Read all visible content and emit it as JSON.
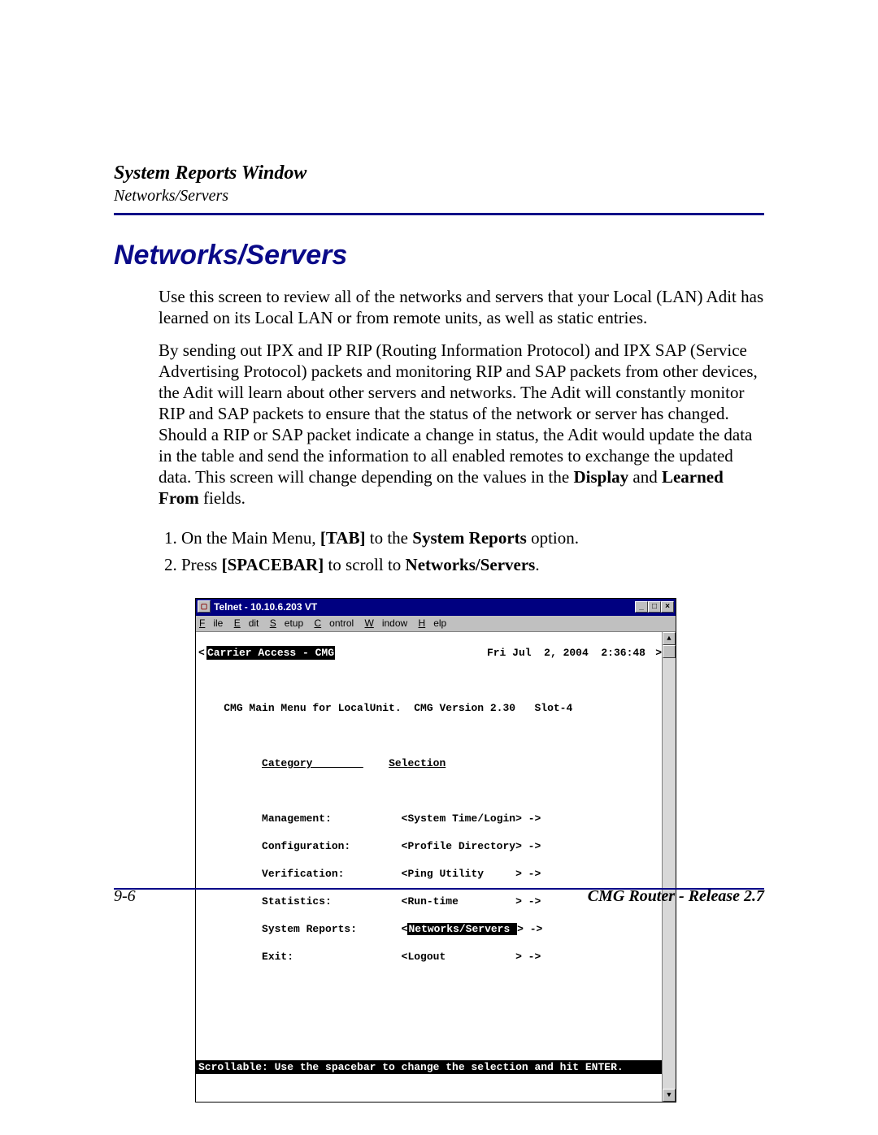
{
  "header": {
    "title": "System Reports Window",
    "subtitle": "Networks/Servers"
  },
  "main_title": "Networks/Servers",
  "paragraph1": "Use this screen to review all of the networks and servers that your Local (LAN) Adit has learned on its Local LAN or from remote units, as well as static entries.",
  "paragraph2_a": "By sending out IPX and IP RIP (Routing Information Protocol) and IPX SAP (Service Advertising Protocol) packets and monitoring RIP and SAP packets from other devices, the Adit will learn about other servers and networks. The Adit will constantly monitor RIP and SAP packets to ensure that the status of the network or server has changed. Should a RIP or SAP packet indicate a change in status, the Adit would update the data in the table and send the information to all enabled remotes to exchange the updated data. This screen will change depending on the values in the ",
  "paragraph2_b": "Display",
  "paragraph2_c": " and ",
  "paragraph2_d": "Learned From",
  "paragraph2_e": " fields.",
  "steps": {
    "s1_a": "On the Main Menu, ",
    "s1_b": "[TAB]",
    "s1_c": " to the ",
    "s1_d": "System Reports",
    "s1_e": " option.",
    "s2_a": "Press ",
    "s2_b": "[SPACEBAR]",
    "s2_c": " to scroll to ",
    "s2_d": "Networks/Servers",
    "s2_e": "."
  },
  "telnet": {
    "title": "Telnet - 10.10.6.203 VT",
    "menu": [
      "File",
      "Edit",
      "Setup",
      "Control",
      "Window",
      "Help"
    ],
    "top_left": "Carrier Access - CMG",
    "top_right": "Fri Jul  2, 2004  2:36:48",
    "subhead": "CMG Main Menu for LocalUnit.  CMG Version 2.30   Slot-4",
    "col1": "Category        ",
    "col2": "Selection",
    "rows": [
      {
        "cat": "Management:",
        "sel": "<System Time/Login> ->",
        "hl": false
      },
      {
        "cat": "Configuration:",
        "sel": "<Profile Directory> ->",
        "hl": false
      },
      {
        "cat": "Verification:",
        "sel": "<Ping Utility     > ->",
        "hl": false
      },
      {
        "cat": "Statistics:",
        "sel": "<Run-time         > ->",
        "hl": false
      },
      {
        "cat": "System Reports:",
        "sel_open": "<",
        "sel_mid": "Networks/Servers ",
        "sel_close": "> ->",
        "hl": true
      },
      {
        "cat": "Exit:",
        "sel": "<Logout           > ->",
        "hl": false
      }
    ],
    "bottom": "Scrollable: Use the spacebar to change the selection and hit ENTER."
  },
  "footer": {
    "left": "9-6",
    "right": "CMG Router - Release 2.7"
  },
  "win_buttons": {
    "min": "_",
    "max": "□",
    "close": "×"
  },
  "scroll": {
    "up": "▲",
    "down": "▼"
  }
}
